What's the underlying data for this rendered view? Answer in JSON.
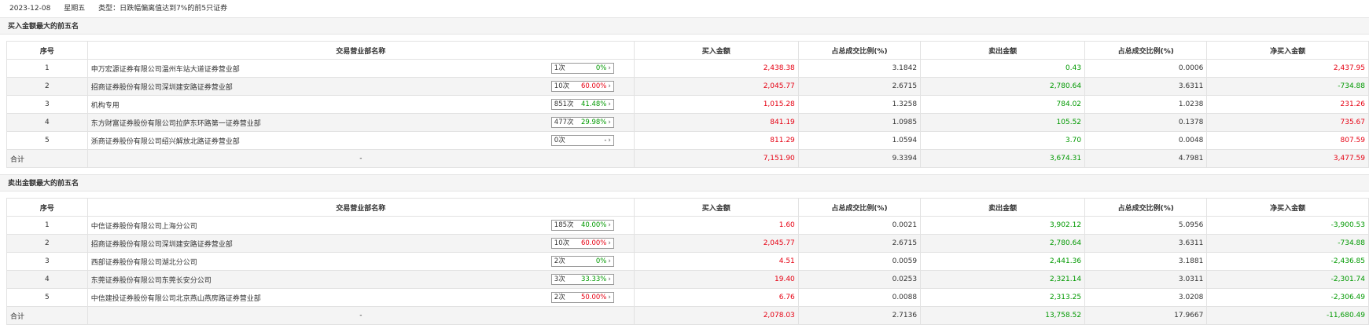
{
  "header": {
    "date": "2023-12-08",
    "weekday": "星期五",
    "type_label": "类型：日跌幅偏离值达到7%的前5只证券"
  },
  "columns": [
    "序号",
    "交易营业部名称",
    "买入金额",
    "占总成交比例(%)",
    "卖出金额",
    "占总成交比例(%)",
    "净买入金额"
  ],
  "buy_section": {
    "title": "买入金额最大的前五名",
    "rows": [
      {
        "idx": "1",
        "name": "申万宏源证券有限公司温州车站大道证券营业部",
        "count": "1次",
        "pct": "0%",
        "pct_color": "green",
        "buy": "2,438.38",
        "buy_ratio": "3.1842",
        "sell": "0.43",
        "sell_ratio": "0.0006",
        "net": "2,437.95",
        "net_color": "red"
      },
      {
        "idx": "2",
        "name": "招商证券股份有限公司深圳建安路证券营业部",
        "count": "10次",
        "pct": "60.00%",
        "pct_color": "red",
        "buy": "2,045.77",
        "buy_ratio": "2.6715",
        "sell": "2,780.64",
        "sell_ratio": "3.6311",
        "net": "-734.88",
        "net_color": "green"
      },
      {
        "idx": "3",
        "name": "机构专用",
        "count": "851次",
        "pct": "41.48%",
        "pct_color": "green",
        "buy": "1,015.28",
        "buy_ratio": "1.3258",
        "sell": "784.02",
        "sell_ratio": "1.0238",
        "net": "231.26",
        "net_color": "red"
      },
      {
        "idx": "4",
        "name": "东方财富证券股份有限公司拉萨东环路第一证券营业部",
        "count": "477次",
        "pct": "29.98%",
        "pct_color": "green",
        "buy": "841.19",
        "buy_ratio": "1.0985",
        "sell": "105.52",
        "sell_ratio": "0.1378",
        "net": "735.67",
        "net_color": "red"
      },
      {
        "idx": "5",
        "name": "浙商证券股份有限公司绍兴解放北路证券营业部",
        "count": "0次",
        "pct": "-",
        "pct_color": "gray",
        "buy": "811.29",
        "buy_ratio": "1.0594",
        "sell": "3.70",
        "sell_ratio": "0.0048",
        "net": "807.59",
        "net_color": "red"
      }
    ],
    "total": {
      "label": "合计",
      "name": "-",
      "buy": "7,151.90",
      "buy_ratio": "9.3394",
      "sell": "3,674.31",
      "sell_ratio": "4.7981",
      "net": "3,477.59",
      "net_color": "red"
    }
  },
  "sell_section": {
    "title": "卖出金额最大的前五名",
    "rows": [
      {
        "idx": "1",
        "name": "中信证券股份有限公司上海分公司",
        "count": "185次",
        "pct": "40.00%",
        "pct_color": "green",
        "buy": "1.60",
        "buy_ratio": "0.0021",
        "sell": "3,902.12",
        "sell_ratio": "5.0956",
        "net": "-3,900.53",
        "net_color": "green"
      },
      {
        "idx": "2",
        "name": "招商证券股份有限公司深圳建安路证券营业部",
        "count": "10次",
        "pct": "60.00%",
        "pct_color": "red",
        "buy": "2,045.77",
        "buy_ratio": "2.6715",
        "sell": "2,780.64",
        "sell_ratio": "3.6311",
        "net": "-734.88",
        "net_color": "green"
      },
      {
        "idx": "3",
        "name": "西部证券股份有限公司湖北分公司",
        "count": "2次",
        "pct": "0%",
        "pct_color": "green",
        "buy": "4.51",
        "buy_ratio": "0.0059",
        "sell": "2,441.36",
        "sell_ratio": "3.1881",
        "net": "-2,436.85",
        "net_color": "green"
      },
      {
        "idx": "4",
        "name": "东莞证券股份有限公司东莞长安分公司",
        "count": "3次",
        "pct": "33.33%",
        "pct_color": "green",
        "buy": "19.40",
        "buy_ratio": "0.0253",
        "sell": "2,321.14",
        "sell_ratio": "3.0311",
        "net": "-2,301.74",
        "net_color": "green"
      },
      {
        "idx": "5",
        "name": "中信建投证券股份有限公司北京燕山燕房路证券营业部",
        "count": "2次",
        "pct": "50.00%",
        "pct_color": "red",
        "buy": "6.76",
        "buy_ratio": "0.0088",
        "sell": "2,313.25",
        "sell_ratio": "3.0208",
        "net": "-2,306.49",
        "net_color": "green"
      }
    ],
    "total": {
      "label": "合计",
      "name": "-",
      "buy": "2,078.03",
      "buy_ratio": "2.7136",
      "sell": "13,758.52",
      "sell_ratio": "17.9667",
      "net": "-11,680.49",
      "net_color": "green"
    }
  },
  "colors": {
    "up": "#e60012",
    "down": "#009900",
    "neutral": "#333333"
  },
  "icons": {
    "badge_arrow": "chevron-right-icon"
  }
}
